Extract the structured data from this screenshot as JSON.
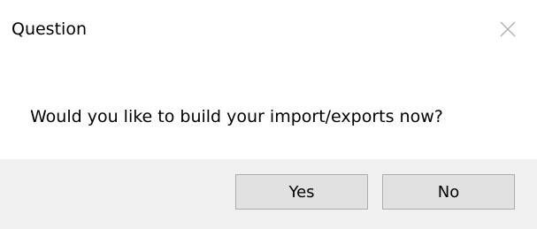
{
  "window": {
    "title": "Question"
  },
  "dialog": {
    "message": "Would you like to build your import/exports now?"
  },
  "buttons": {
    "yes_label": "Yes",
    "no_label": "No"
  },
  "icons": {
    "close": "close-icon"
  },
  "colors": {
    "dialog_background": "#ffffff",
    "footer_background": "#f0f0f0",
    "button_background": "#e1e1e1",
    "button_border": "#adadad",
    "close_icon": "#b0b0b0"
  }
}
